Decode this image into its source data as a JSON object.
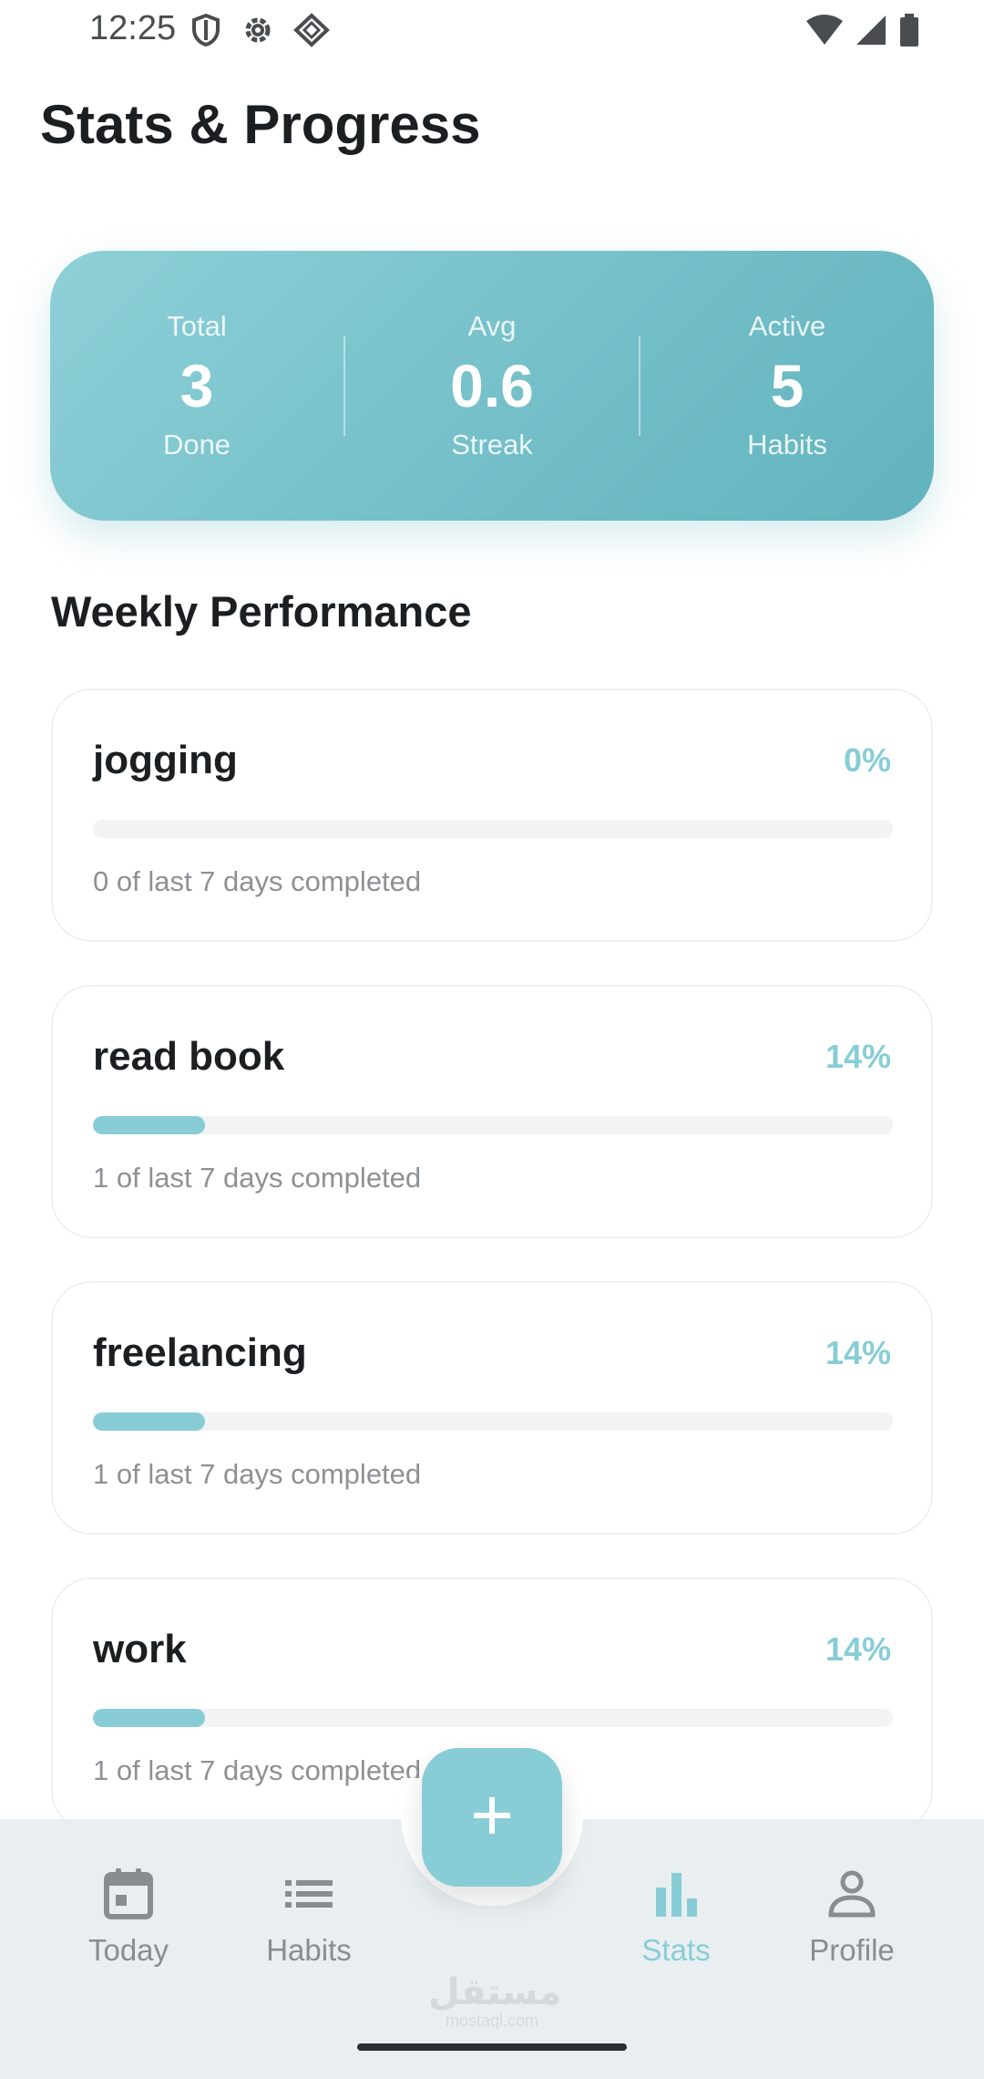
{
  "status_bar": {
    "time": "12:25",
    "left_icons": [
      "shield-icon",
      "gear-icon",
      "vpn-diamond-icon"
    ],
    "right_icons": [
      "wifi-icon",
      "signal-icon",
      "battery-icon"
    ]
  },
  "header": {
    "title": "Stats & Progress"
  },
  "summary": [
    {
      "top": "Total",
      "value": "3",
      "bottom": "Done"
    },
    {
      "top": "Avg",
      "value": "0.6",
      "bottom": "Streak"
    },
    {
      "top": "Active",
      "value": "5",
      "bottom": "Habits"
    }
  ],
  "section": {
    "title": "Weekly Performance"
  },
  "habits": [
    {
      "name": "jogging",
      "percent_label": "0%",
      "progress": 0,
      "caption": "0 of last 7 days completed"
    },
    {
      "name": "read book",
      "percent_label": "14%",
      "progress": 0.14,
      "caption": "1 of last 7 days completed"
    },
    {
      "name": "freelancing",
      "percent_label": "14%",
      "progress": 0.14,
      "caption": "1 of last 7 days completed"
    },
    {
      "name": "work",
      "percent_label": "14%",
      "progress": 0.14,
      "caption": "1 of last 7 days completed"
    }
  ],
  "bottom_nav": {
    "items": [
      {
        "label": "Today",
        "icon": "calendar-icon",
        "active": false
      },
      {
        "label": "Habits",
        "icon": "list-icon",
        "active": false
      },
      {
        "label": "Stats",
        "icon": "bar-chart-icon",
        "active": true
      },
      {
        "label": "Profile",
        "icon": "person-icon",
        "active": false
      }
    ],
    "fab_icon": "plus-icon"
  },
  "watermark": {
    "arabic": "مستقل",
    "latin": "mostaql.com"
  },
  "colors": {
    "accent": "#88cdd6",
    "card_gradient_start": "#8ed0d8",
    "card_gradient_end": "#62b3be",
    "nav_background": "#e9eff1",
    "text_primary": "#1c1f22",
    "text_muted": "#8d9195"
  }
}
